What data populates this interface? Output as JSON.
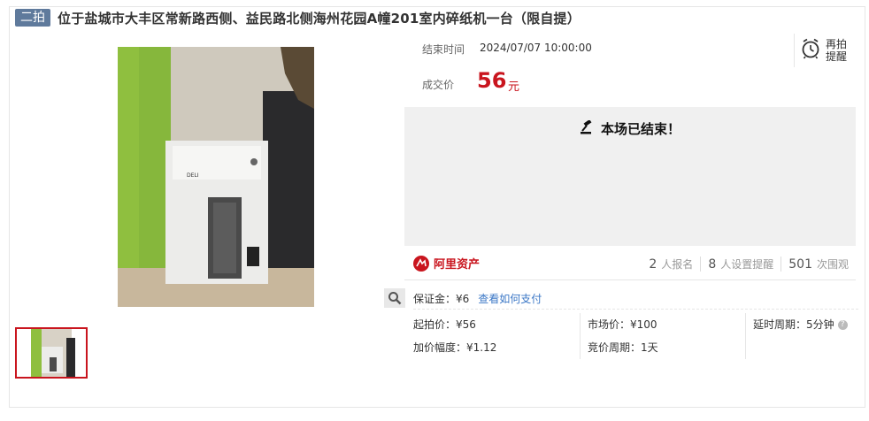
{
  "header": {
    "badge": "二拍",
    "title": "位于盐城市大丰区常新路西侧、益民路北侧海州花园A幢201室内碎纸机一台（限自提）"
  },
  "gallery": {
    "main_image_icon": "paper-shredder-photo",
    "shredder_brand": "DELI",
    "thumbnail_icon": "paper-shredder-thumbnail",
    "zoom_icon": "magnifier-icon"
  },
  "auction": {
    "end_time_label": "结束时间",
    "end_time_value": "2024/07/07 10:00:00",
    "deal_price_label": "成交价",
    "deal_price_value": "56",
    "deal_price_unit": "元",
    "relist_label": "再拍提醒",
    "relist_icon": "alarm-clock-icon",
    "ended_icon": "gavel-icon",
    "ended_text": "本场已结束！"
  },
  "platform": {
    "logo_text": "阿里资产",
    "stats": [
      {
        "num": "2",
        "label": "人报名"
      },
      {
        "num": "8",
        "label": "人设置提醒"
      },
      {
        "num": "501",
        "label": "次围观"
      }
    ]
  },
  "details": {
    "deposit": "保证金：¥6",
    "pay_link": "查看如何支付",
    "start_price": "起拍价：¥56",
    "increment": "加价幅度：¥1.12",
    "market_price": "市场价：¥100",
    "bid_period": "竞价周期：1天",
    "delay_period": "延时周期：5分钟"
  },
  "colors": {
    "accent_red": "#c9151e",
    "badge_blue": "#5f7a9c",
    "link_blue": "#3b77c6"
  }
}
